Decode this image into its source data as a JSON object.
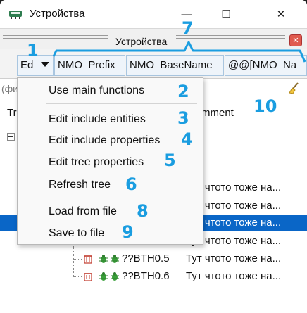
{
  "window": {
    "title": "Устройства",
    "minimize_glyph": "—",
    "maximize_glyph": "☐",
    "close_glyph": "✕"
  },
  "panel": {
    "title": "Устройства",
    "close_glyph": "✕"
  },
  "toolbar": {
    "columns": [
      "Ed",
      "NMO_Prefix",
      "NMO_BaseName",
      "@@[NMO_Na"
    ]
  },
  "filter": {
    "text": "(фи"
  },
  "tree": {
    "headers": [
      "Tr",
      "mment"
    ],
    "rows": [
      {
        "comment": "Тут чтото тоже на...",
        "selected": false
      },
      {
        "comment": "Тут чтото тоже на...",
        "selected": false
      },
      {
        "comment": "Тут чтото тоже на...",
        "selected": true
      },
      {
        "comment": "Тут чтото тоже на...",
        "selected": false
      },
      {
        "name": "??BTH0.5",
        "comment": "Тут чтото тоже на...",
        "selected": false
      },
      {
        "name": "??BTH0.6",
        "comment": "Тут чтото тоже на...",
        "selected": false
      }
    ]
  },
  "menu": {
    "items": [
      {
        "label": "Use main functions"
      },
      {
        "label": "Edit include entities"
      },
      {
        "label": "Edit include properties"
      },
      {
        "label": "Edit tree properties"
      },
      {
        "label": "Refresh tree"
      },
      {
        "label": "Load from file"
      },
      {
        "label": "Save to file"
      }
    ]
  },
  "annotations": [
    "1",
    "2",
    "3",
    "4",
    "5",
    "6",
    "7",
    "8",
    "9",
    "10"
  ],
  "icons": {
    "app": "device-chip-icon",
    "broom": "clear-filter-broom-icon",
    "trash": "delete-icon",
    "bug": "bug-icon"
  },
  "colors": {
    "accent": "#1a9de0",
    "selection": "#0a66c7",
    "panel_close": "#e05a4e"
  }
}
